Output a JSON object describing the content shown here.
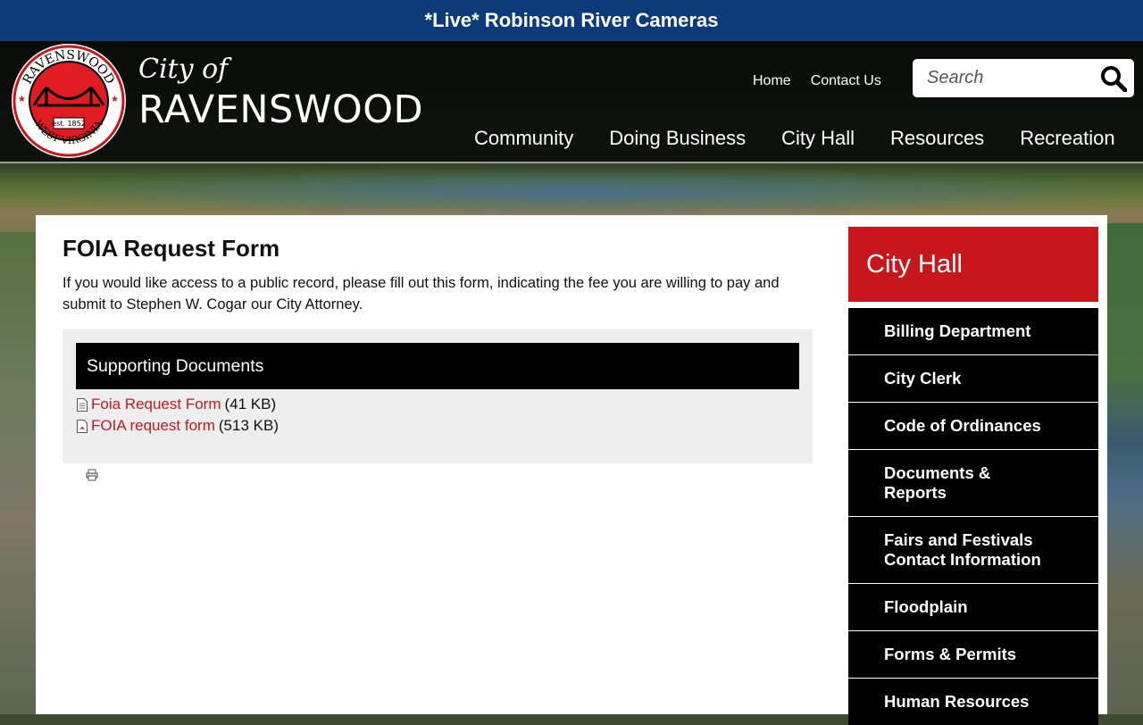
{
  "alert": {
    "text": "*Live* Robinson River Cameras"
  },
  "brand": {
    "city_of": "City of",
    "name": "RAVENSWOOD",
    "seal_top": "RAVENSWOOD",
    "seal_bottom": "WEST VIRGINIA",
    "seal_est": "est. 1852"
  },
  "utility_nav": {
    "home": "Home",
    "contact": "Contact Us"
  },
  "search": {
    "placeholder": "Search"
  },
  "main_nav": {
    "items": [
      {
        "label": "Community"
      },
      {
        "label": "Doing Business"
      },
      {
        "label": "City Hall"
      },
      {
        "label": "Resources"
      },
      {
        "label": "Recreation"
      }
    ]
  },
  "page": {
    "title": "FOIA Request Form",
    "intro": "If you would like access to a public record, please fill out this form, indicating the fee you are willing to pay and submit to Stephen W. Cogar our City Attorney."
  },
  "documents": {
    "header": "Supporting Documents",
    "items": [
      {
        "name": "Foia Request Form",
        "size": "(41 KB)",
        "icon": "document-icon"
      },
      {
        "name": "FOIA request form",
        "size": "(513 KB)",
        "icon": "pdf-icon"
      }
    ]
  },
  "sidebar": {
    "title": "City Hall",
    "items": [
      {
        "label": "Billing Department"
      },
      {
        "label": "City Clerk"
      },
      {
        "label": "Code of Ordinances"
      },
      {
        "label": "Documents & Reports"
      },
      {
        "label": "Fairs and Festivals Contact Information"
      },
      {
        "label": "Floodplain"
      },
      {
        "label": "Forms & Permits"
      },
      {
        "label": "Human Resources"
      }
    ]
  },
  "colors": {
    "alert_bg": "#0d3b7a",
    "accent_red": "#c8161d",
    "sidebar_item_bg": "#000000"
  }
}
